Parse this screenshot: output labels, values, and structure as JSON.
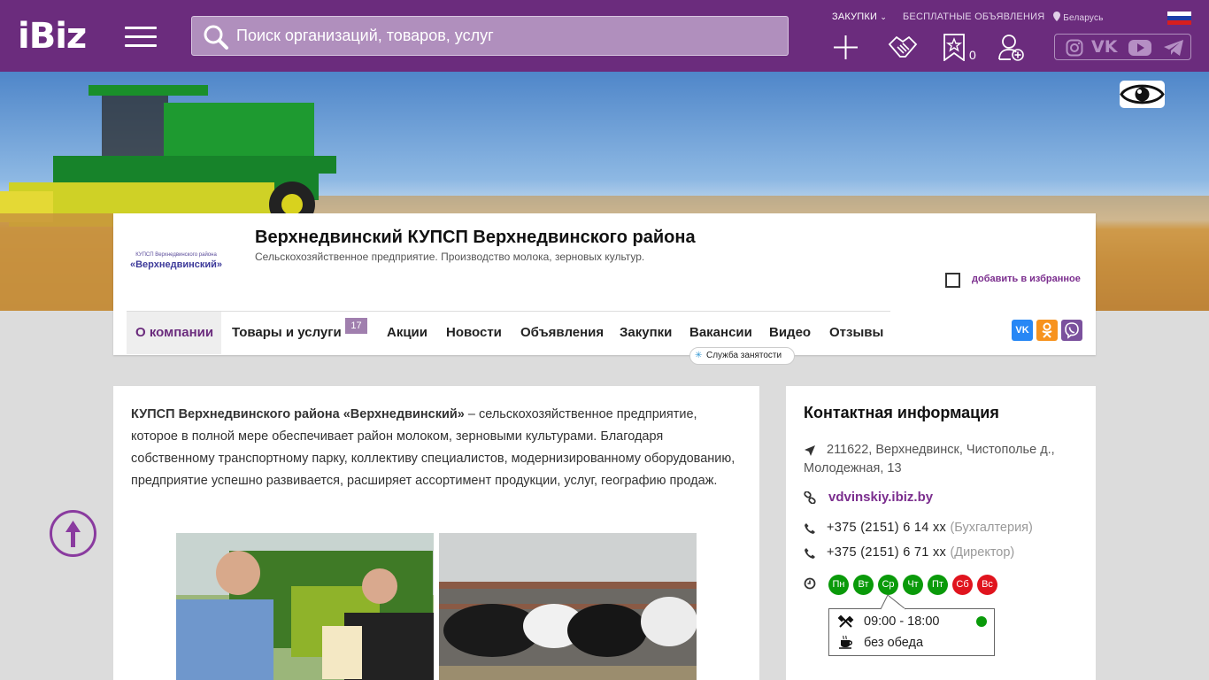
{
  "header": {
    "logo": "iBiz",
    "search_placeholder": "Поиск организаций, товаров, услуг",
    "links": {
      "purchases": "ЗАКУПКИ",
      "free_ads": "БЕСПЛАТНЫЕ ОБЪЯВЛЕНИЯ",
      "region": "Беларусь"
    },
    "favorites_count": "0",
    "icons": [
      "add-icon",
      "handshake-icon",
      "favorites-icon",
      "add-user-icon"
    ],
    "social": [
      "instagram-icon",
      "vk-icon",
      "youtube-icon",
      "telegram-icon"
    ]
  },
  "company": {
    "logo_small": "КУПСП Верхнедвинского района",
    "logo_big": "«Верхнедвинский»",
    "title": "Верхнедвинский КУПСП Верхнедвинского района",
    "subtitle": "Сельскохозяйственное предприятие. Производство молока, зерновых культур.",
    "add_favorite": "добавить в избранное",
    "tabs": [
      {
        "label": "О компании"
      },
      {
        "label": "Товары и услуги",
        "count": "17"
      },
      {
        "label": "Акции"
      },
      {
        "label": "Новости"
      },
      {
        "label": "Объявления"
      },
      {
        "label": "Закупки"
      },
      {
        "label": "Вакансии"
      },
      {
        "label": "Видео"
      },
      {
        "label": "Отзывы"
      }
    ],
    "employment_service": "Служба занятости",
    "share": [
      "VK",
      "OK",
      "Viber"
    ]
  },
  "about": {
    "lead": "КУПСП Верхнедвинского района «Верхнедвинский»",
    "text": " – сельскохозяйственное предприятие, которое в полной мере обеспечивает район молоком, зерновыми культурами. Благодаря собственному транспортному парку, коллективу специалистов, модернизированному оборудованию, предприятие успешно развивается, расширяет ассортимент продукции, услуг, географию продаж."
  },
  "contacts": {
    "title": "Контактная информация",
    "address": "211622, Верхнедвинск, Чистополье д., Молодежная, 13",
    "site": "vdvinskiy.ibiz.by",
    "phones": [
      {
        "number": "+375 (2151) 6 14 xx",
        "note": "(Бухгалтерия)"
      },
      {
        "number": "+375 (2151) 6 71 xx",
        "note": "(Директор)"
      }
    ],
    "days": [
      {
        "label": "Пн",
        "color": "#0a9a0a"
      },
      {
        "label": "Вт",
        "color": "#0a9a0a"
      },
      {
        "label": "Ср",
        "color": "#0a9a0a"
      },
      {
        "label": "Чт",
        "color": "#0a9a0a"
      },
      {
        "label": "Пт",
        "color": "#0a9a0a"
      },
      {
        "label": "Сб",
        "color": "#e0141e"
      },
      {
        "label": "Вс",
        "color": "#e0141e"
      }
    ],
    "hours": "09:00 - 18:00",
    "lunch": "без обеда"
  },
  "colors": {
    "brand": "#6b2c7d",
    "accent": "#7b2e8e",
    "open": "#0a9a0a",
    "closed": "#e0141e"
  }
}
